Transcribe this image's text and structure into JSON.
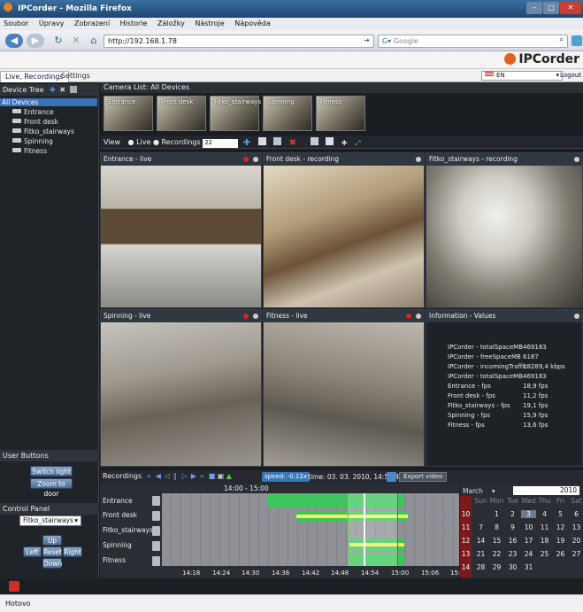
{
  "browser": {
    "window_title": "IPCorder - Mozilla Firefox",
    "menu": [
      "Soubor",
      "Úpravy",
      "Zobrazení",
      "Historie",
      "Záložky",
      "Nástroje",
      "Nápověda"
    ],
    "url": "http://192.168.1.78",
    "search_placeholder": "Google",
    "status": "Hotovo"
  },
  "app": {
    "brand": "IPCorder",
    "tabs": [
      "Live, Recordings",
      "Settings"
    ],
    "language": "EN",
    "logout": "Logout"
  },
  "left": {
    "device_tree_title": "Device Tree",
    "root": "All Devices",
    "devices": [
      "Entrance",
      "Front desk",
      "Fitko_stairways",
      "Spinning",
      "Fitness"
    ],
    "user_buttons_title": "User Buttons",
    "user_buttons": [
      "Switch light",
      "Zoom to door"
    ],
    "control_panel_title": "Control Panel",
    "control_select": "Fitko_stairways",
    "controls": {
      "up": "Up",
      "left": "Left",
      "reset": "Reset",
      "right": "Right",
      "down": "Down"
    }
  },
  "camera_list": {
    "title": "Camera List: All Devices",
    "thumbs": [
      "Entrance",
      "Front desk",
      "Fitko_stairways",
      "Spinning",
      "Fitness"
    ]
  },
  "view_bar": {
    "label": "View",
    "live": "Live",
    "recordings": "Recordings",
    "layout_value": "22"
  },
  "tiles": [
    {
      "title": "Entrance - live"
    },
    {
      "title": "Front desk - recording"
    },
    {
      "title": "Fitko_stairways - recording"
    },
    {
      "title": "Spinning - live"
    },
    {
      "title": "Fitness - live"
    }
  ],
  "info": {
    "title": "Information - Values",
    "rows": [
      {
        "k": "IPCorder - totalSpaceMB",
        "v": "469183"
      },
      {
        "k": "IPCorder - freeSpaceMB",
        "v": "6187"
      },
      {
        "k": "IPCorder - incomingTraffic",
        "v": "18289,4 kbps"
      },
      {
        "k": "IPCorder - totalSpaceMB",
        "v": "469183"
      },
      {
        "k": "Entrance - fps",
        "v": "18,9 fps"
      },
      {
        "k": "Front desk - fps",
        "v": "11,2 fps"
      },
      {
        "k": "Fitko_stairways - fps",
        "v": "19,1 fps"
      },
      {
        "k": "Spinning - fps",
        "v": "15,9 fps"
      },
      {
        "k": "Fitness - fps",
        "v": "13,6 fps"
      }
    ]
  },
  "recordings_bar": {
    "label": "Recordings",
    "speed": "speed: -0.12x",
    "time": "time: 03. 03. 2010, 14:52:42",
    "export": "Export video"
  },
  "timeline": {
    "range": "14:00 - 15:00",
    "rows": [
      "Entrance",
      "Front desk",
      "Fitko_stairways",
      "Spinning",
      "Fitness"
    ],
    "ticks": [
      "14:18",
      "14:24",
      "14:30",
      "14:36",
      "14:42",
      "14:48",
      "14:54",
      "15:00",
      "15:06",
      "15:1"
    ]
  },
  "calendar": {
    "month": "March",
    "year": "2010",
    "day_heads": [
      "Sun",
      "Mon",
      "Tue",
      "Wed",
      "Thu",
      "Fri",
      "Sat"
    ],
    "weeks": [
      {
        "wk": "",
        "days": [
          "",
          "",
          "",
          "",
          "",
          "",
          ""
        ]
      },
      {
        "wk": "10",
        "days": [
          "",
          "1",
          "2",
          "3",
          "4",
          "5",
          "6"
        ]
      },
      {
        "wk": "11",
        "days": [
          "7",
          "8",
          "9",
          "10",
          "11",
          "12",
          "13"
        ]
      },
      {
        "wk": "12",
        "days": [
          "14",
          "15",
          "16",
          "17",
          "18",
          "19",
          "20"
        ]
      },
      {
        "wk": "13",
        "days": [
          "21",
          "22",
          "23",
          "24",
          "25",
          "26",
          "27"
        ]
      },
      {
        "wk": "14",
        "days": [
          "28",
          "29",
          "30",
          "31",
          "",
          "",
          ""
        ]
      }
    ],
    "selected_day": "3"
  }
}
